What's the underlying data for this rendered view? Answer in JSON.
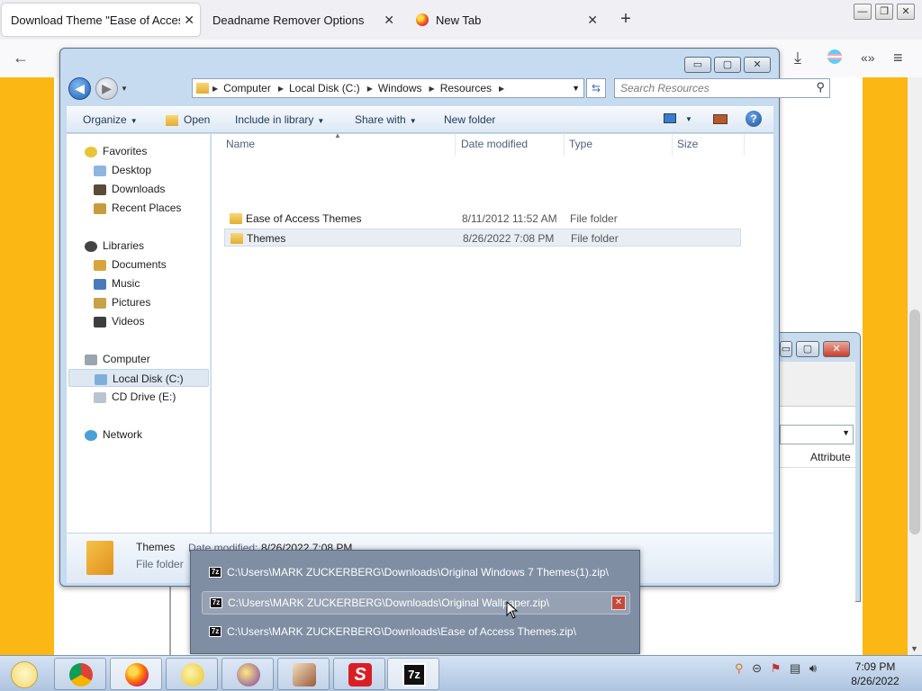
{
  "browser": {
    "tabs": [
      {
        "title": "Download Theme \"Ease of Access T",
        "active": true
      },
      {
        "title": "Deadname Remover Options",
        "active": false
      },
      {
        "title": "New Tab",
        "active": false
      }
    ],
    "new_tab": "+",
    "window_controls": {
      "minimize": "—",
      "restore": "❐",
      "close": "✕"
    }
  },
  "explorer": {
    "breadcrumbs": [
      "Computer",
      "Local Disk (C:)",
      "Windows",
      "Resources"
    ],
    "search_placeholder": "Search Resources",
    "commands": {
      "organize": "Organize",
      "open": "Open",
      "include_in_library": "Include in library",
      "share_with": "Share with",
      "new_folder": "New folder"
    },
    "nav": {
      "favorites": "Favorites",
      "favorites_items": [
        "Desktop",
        "Downloads",
        "Recent Places"
      ],
      "libraries": "Libraries",
      "libraries_items": [
        "Documents",
        "Music",
        "Pictures",
        "Videos"
      ],
      "computer": "Computer",
      "computer_items": [
        "Local Disk (C:)",
        "CD Drive (E:)"
      ],
      "network": "Network"
    },
    "columns": {
      "name": "Name",
      "date_modified": "Date modified",
      "type": "Type",
      "size": "Size"
    },
    "files": [
      {
        "name": "Ease of Access Themes",
        "date": "8/11/2012 11:52 AM",
        "type": "File folder"
      },
      {
        "name": "Themes",
        "date": "8/26/2022 7:08 PM",
        "type": "File folder"
      }
    ],
    "details": {
      "name": "Themes",
      "date_label": "Date modified:",
      "date": "8/26/2022 7:08 PM",
      "type": "File folder"
    }
  },
  "background_window": {
    "column_attributes": "Attribute"
  },
  "jumplist": {
    "items": [
      "C:\\Users\\MARK ZUCKERBERG\\Downloads\\Original Windows 7 Themes(1).zip\\",
      "C:\\Users\\MARK ZUCKERBERG\\Downloads\\Original Wallpaper.zip\\",
      "C:\\Users\\MARK ZUCKERBERG\\Downloads\\Ease of Access Themes.zip\\"
    ],
    "hovered_index": 1
  },
  "taskbar": {
    "clock_time": "7:09 PM",
    "clock_date": "8/26/2022",
    "sevenzip_label": "7z"
  },
  "colors": {
    "page_yellow": "#fbb713",
    "aero_frame": "#c6dbf0",
    "jumplist_bg": "#7f8ea3"
  }
}
